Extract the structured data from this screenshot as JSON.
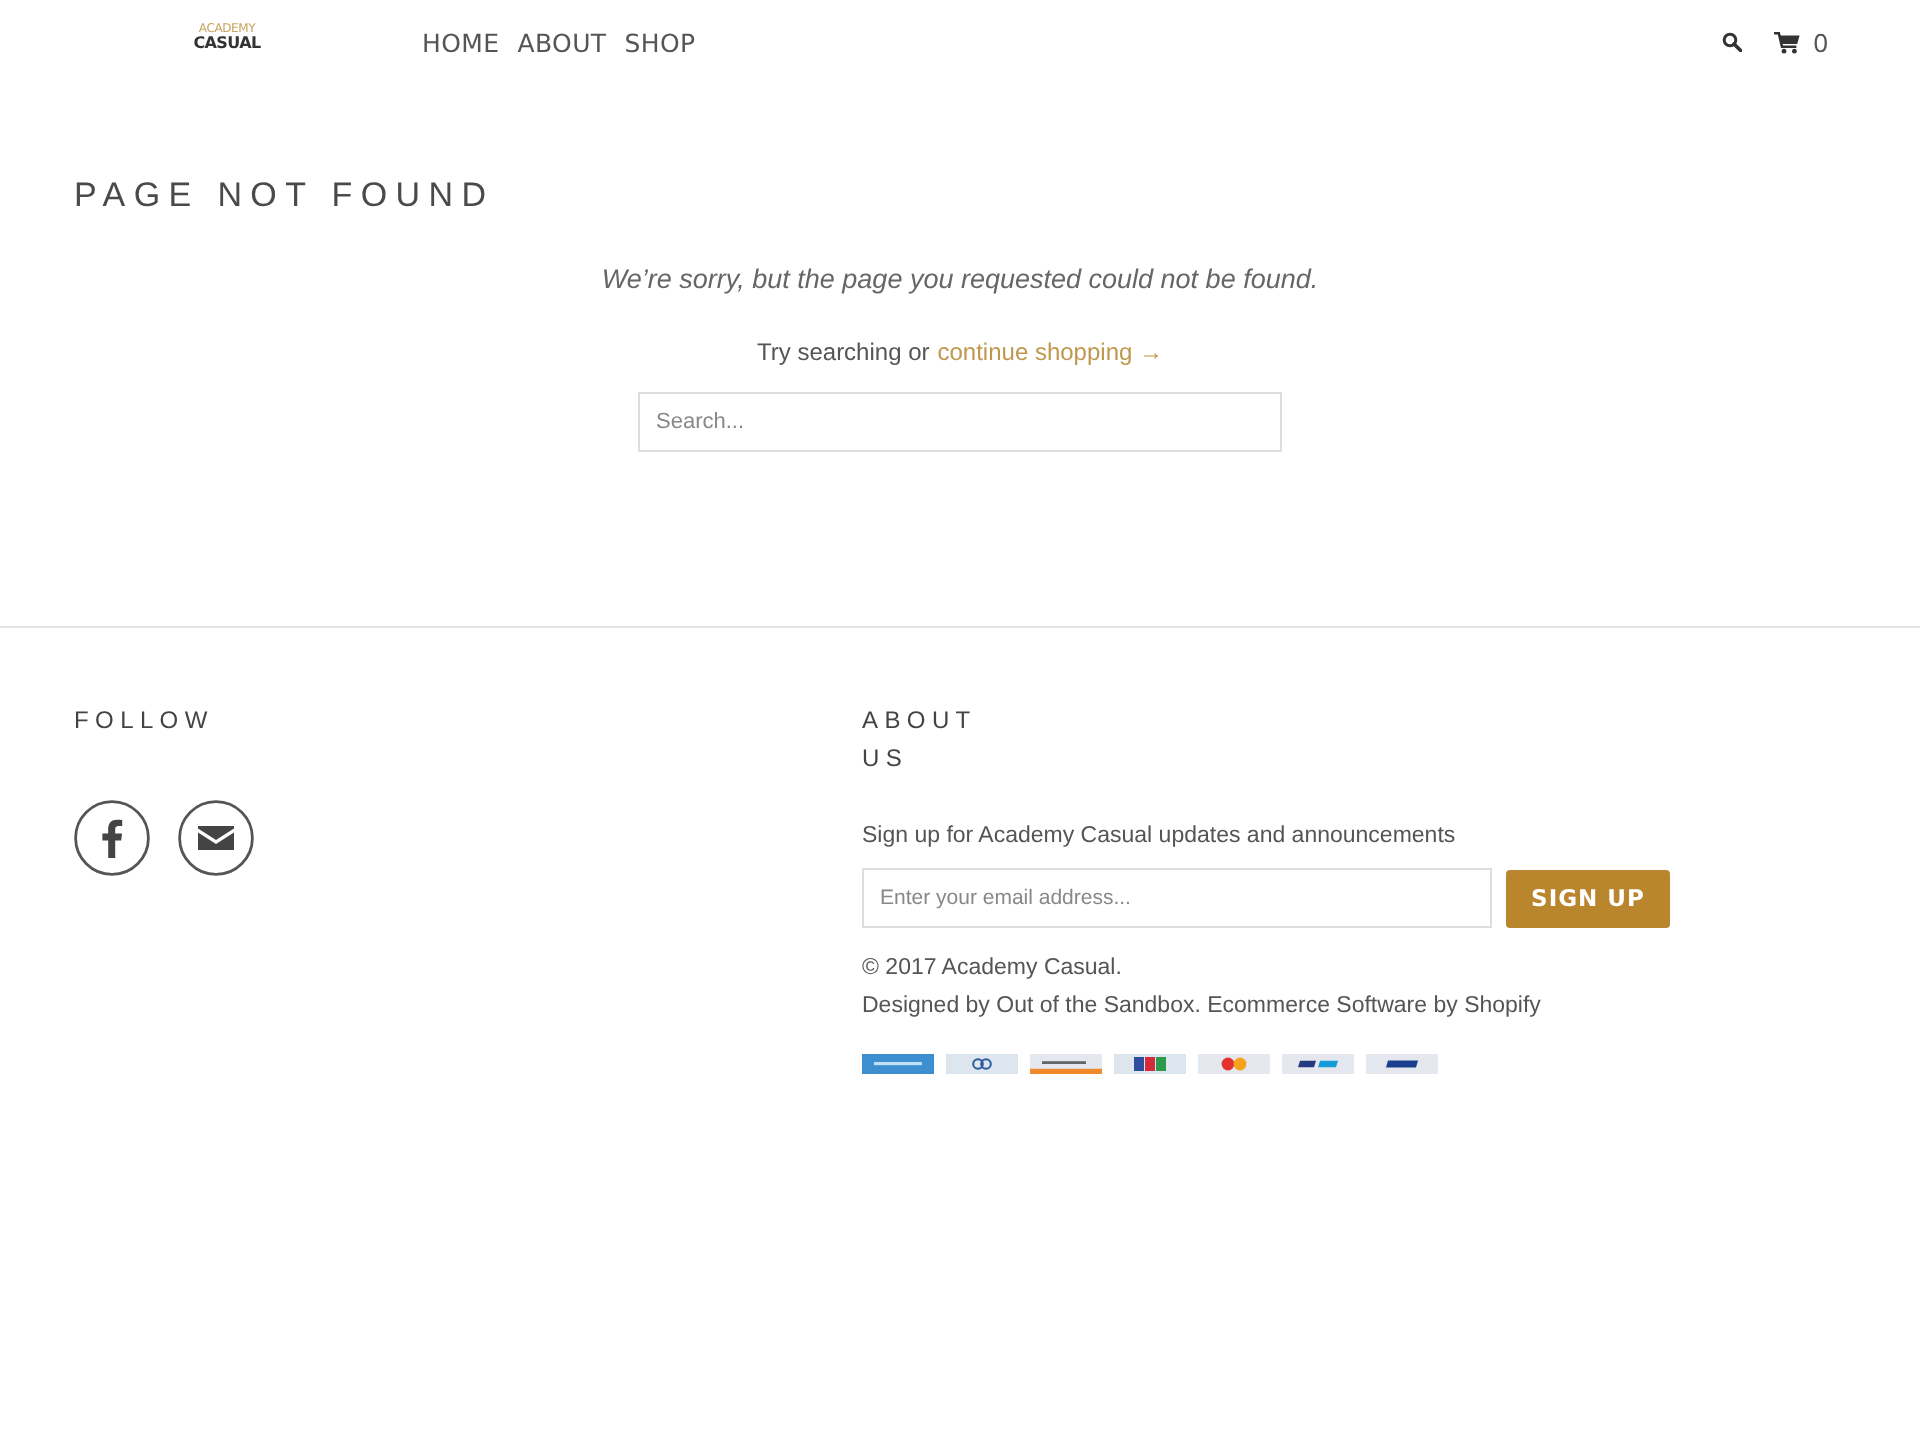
{
  "header": {
    "logo": {
      "line_1": "ACADEMY",
      "line_2": "CASUAL"
    },
    "nav": [
      {
        "label": "HOME"
      },
      {
        "label": "ABOUT"
      },
      {
        "label": "SHOP"
      }
    ],
    "cart_count": "0"
  },
  "main": {
    "title": "PAGE NOT FOUND",
    "message": "We’re sorry, but the page you requested could not be found.",
    "hint": "Try searching or",
    "link": "continue shopping →",
    "search": {
      "placeholder": "Search..."
    }
  },
  "footer": {
    "follow": {
      "title": "FOLLOW",
      "social": [
        {
          "kind": "facebook"
        },
        {
          "kind": "email"
        }
      ]
    },
    "about": {
      "title": "ABOUT US",
      "signup_text": "Sign up for Academy Casual updates and announcements",
      "email": {
        "placeholder": "Enter your email address..."
      },
      "button": "SIGN UP",
      "copyright": "© 2017 Academy Casual.",
      "credits": "Designed by Out of the Sandbox. Ecommerce Software by Shopify",
      "payment_cards": [
        {
          "kind": "amex"
        },
        {
          "kind": "diners"
        },
        {
          "kind": "discover"
        },
        {
          "kind": "jcb"
        },
        {
          "kind": "mastercard"
        },
        {
          "kind": "paypal"
        },
        {
          "kind": "visa"
        }
      ]
    }
  }
}
